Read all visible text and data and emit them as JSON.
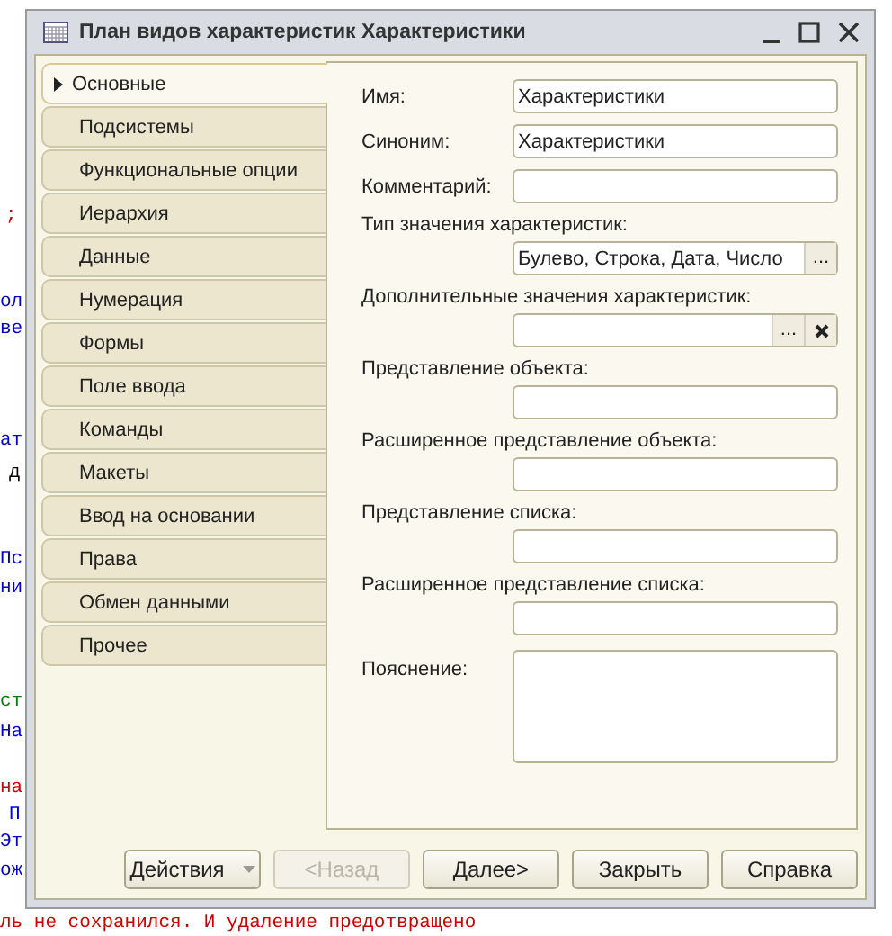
{
  "background_code": [
    {
      "text": ";",
      "color": "#cc0000"
    },
    {
      "text": "ол",
      "color": "#0000cc"
    },
    {
      "text": "ве",
      "color": "#0000cc"
    },
    {
      "text": "ат",
      "color": "#0000cc"
    },
    {
      "text": "д",
      "color": "#000000"
    },
    {
      "text": "Пс",
      "color": "#0000cc"
    },
    {
      "text": "ни",
      "color": "#0000cc"
    },
    {
      "text": "ст",
      "color": "#008000"
    },
    {
      "text": "На",
      "color": "#0000cc"
    },
    {
      "text": "на",
      "color": "#cc0000"
    },
    {
      "text": "П",
      "color": "#0000cc"
    },
    {
      "text": "Эт",
      "color": "#0000cc"
    },
    {
      "text": "ож",
      "color": "#0000cc"
    },
    {
      "text": "ль не сохранился. И удаление предотвращено",
      "color": "#cc0000"
    }
  ],
  "window": {
    "title": "План видов характеристик Характеристики"
  },
  "tabs": [
    {
      "label": "Основные",
      "selected": true
    },
    {
      "label": "Подсистемы",
      "selected": false
    },
    {
      "label": "Функциональные опции",
      "selected": false
    },
    {
      "label": "Иерархия",
      "selected": false
    },
    {
      "label": "Данные",
      "selected": false
    },
    {
      "label": "Нумерация",
      "selected": false
    },
    {
      "label": "Формы",
      "selected": false
    },
    {
      "label": "Поле ввода",
      "selected": false
    },
    {
      "label": "Команды",
      "selected": false
    },
    {
      "label": "Макеты",
      "selected": false
    },
    {
      "label": "Ввод на основании",
      "selected": false
    },
    {
      "label": "Права",
      "selected": false
    },
    {
      "label": "Обмен данными",
      "selected": false
    },
    {
      "label": "Прочее",
      "selected": false
    }
  ],
  "fields": [
    {
      "kind": "inline",
      "label": "Имя:",
      "value": "Характеристики"
    },
    {
      "kind": "inline",
      "label": "Синоним:",
      "value": "Характеристики"
    },
    {
      "kind": "inline",
      "label": "Комментарий:"
    },
    {
      "kind": "stacked",
      "label": "Тип значения характеристик:",
      "value": "Булево, Строка, Дата, Число",
      "buttons": [
        {
          "kind": "choose",
          "label": "..."
        }
      ]
    },
    {
      "kind": "stacked",
      "label": "Дополнительные значения характеристик:",
      "buttons": [
        {
          "kind": "choose",
          "label": "..."
        },
        {
          "kind": "clear"
        }
      ]
    },
    {
      "kind": "stacked",
      "label": "Представление объекта:"
    },
    {
      "kind": "stacked",
      "label": "Расширенное представление объекта:"
    },
    {
      "kind": "stacked",
      "label": "Представление списка:"
    },
    {
      "kind": "stacked",
      "label": "Расширенное представление списка:"
    },
    {
      "kind": "textarea",
      "label": "Пояснение:"
    }
  ],
  "buttons": [
    {
      "label": "Действия",
      "kind": "menu",
      "disabled": false
    },
    {
      "label": "<Назад",
      "kind": "plain",
      "disabled": true
    },
    {
      "label": "Далее>",
      "kind": "plain",
      "disabled": false
    },
    {
      "label": "Закрыть",
      "kind": "plain",
      "disabled": false
    },
    {
      "label": "Справка",
      "kind": "plain",
      "disabled": false
    }
  ]
}
